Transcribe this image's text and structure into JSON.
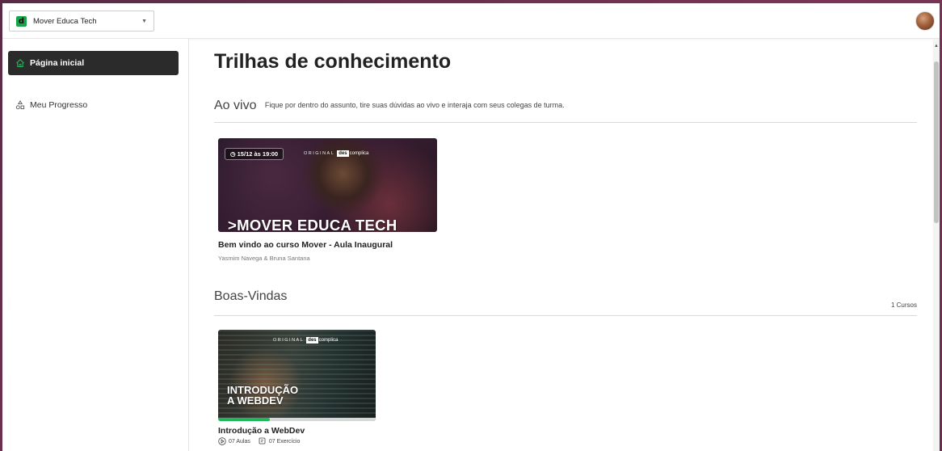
{
  "org_selector": {
    "name": "Mover Educa Tech"
  },
  "sidebar": {
    "items": [
      {
        "label": "Página inicial",
        "active": true
      },
      {
        "label": "Meu Progresso",
        "active": false
      }
    ]
  },
  "main": {
    "title": "Trilhas de conhecimento",
    "live_section": {
      "title": "Ao vivo",
      "description": "Fique por dentro do assunto, tire suas dúvidas ao vivo e interaja com seus colegas de turma.",
      "card": {
        "badge": "15/12 às 19:00",
        "brand_prefix": "ORIGINAL",
        "brand_highlight": "des",
        "brand_rest": "complica",
        "thumb_title": ">MOVER EDUCA TECH",
        "title": "Bem vindo ao curso Mover - Aula Inaugural",
        "subtitle": "Yasmim Navega & Bruna Santana"
      }
    },
    "welcome_section": {
      "title": "Boas-Vindas",
      "count": "1 Cursos",
      "card": {
        "brand_prefix": "ORIGINAL",
        "brand_highlight": "des",
        "brand_rest": "complica",
        "thumb_title_line1": "INTRODUÇÃO",
        "thumb_title_line2": "A WEBDEV",
        "progress": 0.33,
        "title": "Introdução a WebDev",
        "lessons": "07 Aulas",
        "exercises": "07 Exercício"
      }
    }
  },
  "colors": {
    "accent_green": "#1fb85a",
    "sidebar_active_bg": "#2b2b2b",
    "logo_green": "#19a44a"
  }
}
